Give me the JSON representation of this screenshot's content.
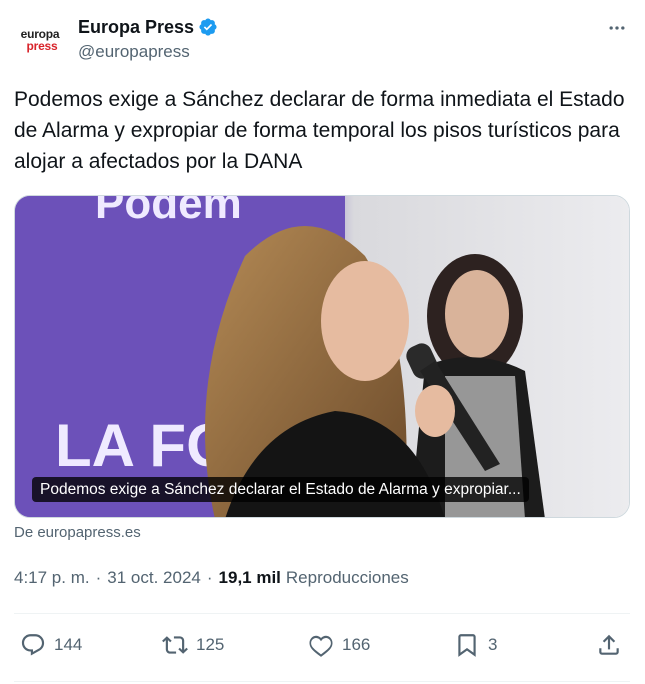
{
  "author": {
    "logo_line1": "europa",
    "logo_line2": "press",
    "display_name": "Europa Press",
    "handle": "@europapress",
    "verified": true
  },
  "tweet": {
    "text": "Podemos exige a Sánchez declarar de forma inmediata el Estado de Alarma y expropiar de forma temporal los pisos turísticos para alojar a afectados por la DANA"
  },
  "card": {
    "caption": "Podemos exige a Sánchez declarar el Estado de Alarma y expropiar...",
    "source": "De europapress.es"
  },
  "meta": {
    "time": "4:17 p. m.",
    "date": "31 oct. 2024",
    "views_count": "19,1 mil",
    "views_label": "Reproducciones"
  },
  "actions": {
    "replies": "144",
    "reposts": "125",
    "likes": "166",
    "bookmarks": "3"
  },
  "colors": {
    "text": "#0f1419",
    "secondary": "#536471",
    "verified": "#1d9bf0",
    "brand_red": "#d8232a",
    "backdrop_purple": "#6a4fb8"
  }
}
